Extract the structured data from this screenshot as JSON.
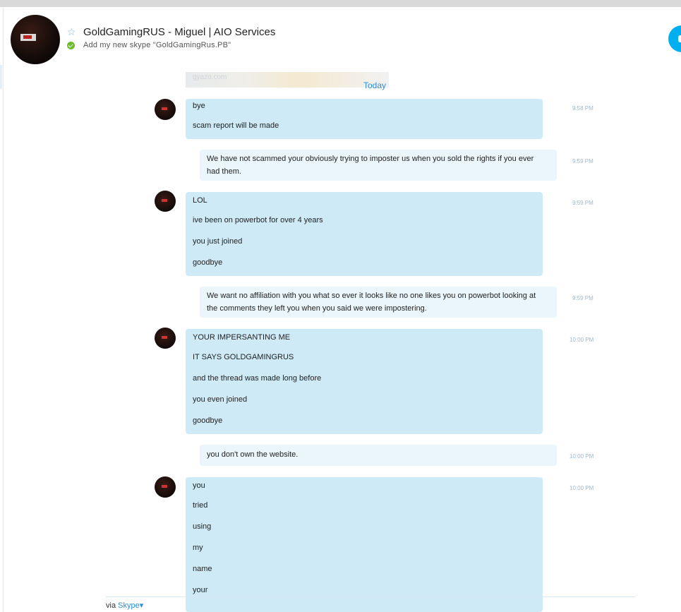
{
  "header": {
    "contact_name": "GoldGamingRUS - Miguel | AIO Services",
    "mood_message": "Add my new skype \"GoldGamingRus.PB\""
  },
  "chat": {
    "thumbnail_watermark": "gyazo.com",
    "date_divider": "Today",
    "messages": [
      {
        "direction": "in",
        "lines": [
          "bye",
          "scam report will be made"
        ],
        "time": "9:58 PM"
      },
      {
        "direction": "out",
        "text": "We have not scammed your obviously trying to imposter us when you sold the rights if you ever had them.",
        "time": "9:59 PM"
      },
      {
        "direction": "in",
        "lines": [
          "LOL",
          "ive been on powerbot for over 4 years",
          "you just joined",
          "goodbye"
        ],
        "time": "9:59 PM"
      },
      {
        "direction": "out",
        "text": "We want no affiliation with you what so ever it looks like no one likes you on powerbot looking at the comments they left you when you said we were impostering.",
        "time": "9:59 PM"
      },
      {
        "direction": "in",
        "lines": [
          "YOUR IMPERSANTING ME",
          "IT SAYS GOLDGAMINGRUS",
          "and the thread was made long before",
          "you even joined",
          "goodbye"
        ],
        "time": "10:00 PM"
      },
      {
        "direction": "out",
        "text": "you don't own the website.",
        "time": "10:00 PM"
      },
      {
        "direction": "in",
        "lines": [
          "you",
          "tried",
          "using",
          "my",
          "name",
          "your"
        ],
        "time": "10:00 PM"
      }
    ]
  },
  "footer": {
    "via_prefix": "via",
    "via_service": "Skype"
  },
  "colors": {
    "incoming_bubble": "#cfeaf7",
    "outgoing_bubble": "#eaf6fc",
    "accent": "#00aff0",
    "link": "#2b8dd6",
    "online": "#6cbd2a"
  },
  "icons": {
    "favorite": "star-icon",
    "status": "online-check-icon",
    "call": "call-icon"
  }
}
